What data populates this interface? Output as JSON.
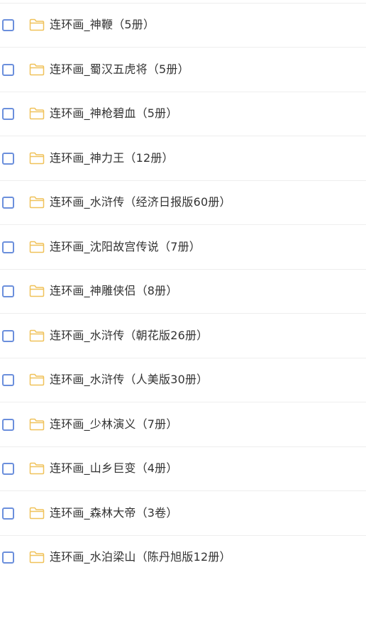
{
  "items": [
    {
      "name": "连环画_神鞭（5册）"
    },
    {
      "name": "连环画_蜀汉五虎将（5册）"
    },
    {
      "name": "连环画_神枪碧血（5册）"
    },
    {
      "name": "连环画_神力王（12册）"
    },
    {
      "name": "连环画_水浒传（经济日报版60册）"
    },
    {
      "name": "连环画_沈阳故宫传说（7册）"
    },
    {
      "name": "连环画_神雕侠侣（8册）"
    },
    {
      "name": "连环画_水浒传（朝花版26册）"
    },
    {
      "name": "连环画_水浒传（人美版30册）"
    },
    {
      "name": "连环画_少林演义（7册）"
    },
    {
      "name": "连环画_山乡巨变（4册）"
    },
    {
      "name": "连环画_森林大帝（3卷）"
    },
    {
      "name": "连环画_水泊梁山（陈丹旭版12册）"
    }
  ],
  "colors": {
    "checkbox_border": "#6b8fdc",
    "folder_stroke": "#f0c25a",
    "text": "#333333",
    "divider": "#eeeeee"
  },
  "icons": {
    "checkbox": "checkbox-icon",
    "folder": "folder-icon"
  }
}
